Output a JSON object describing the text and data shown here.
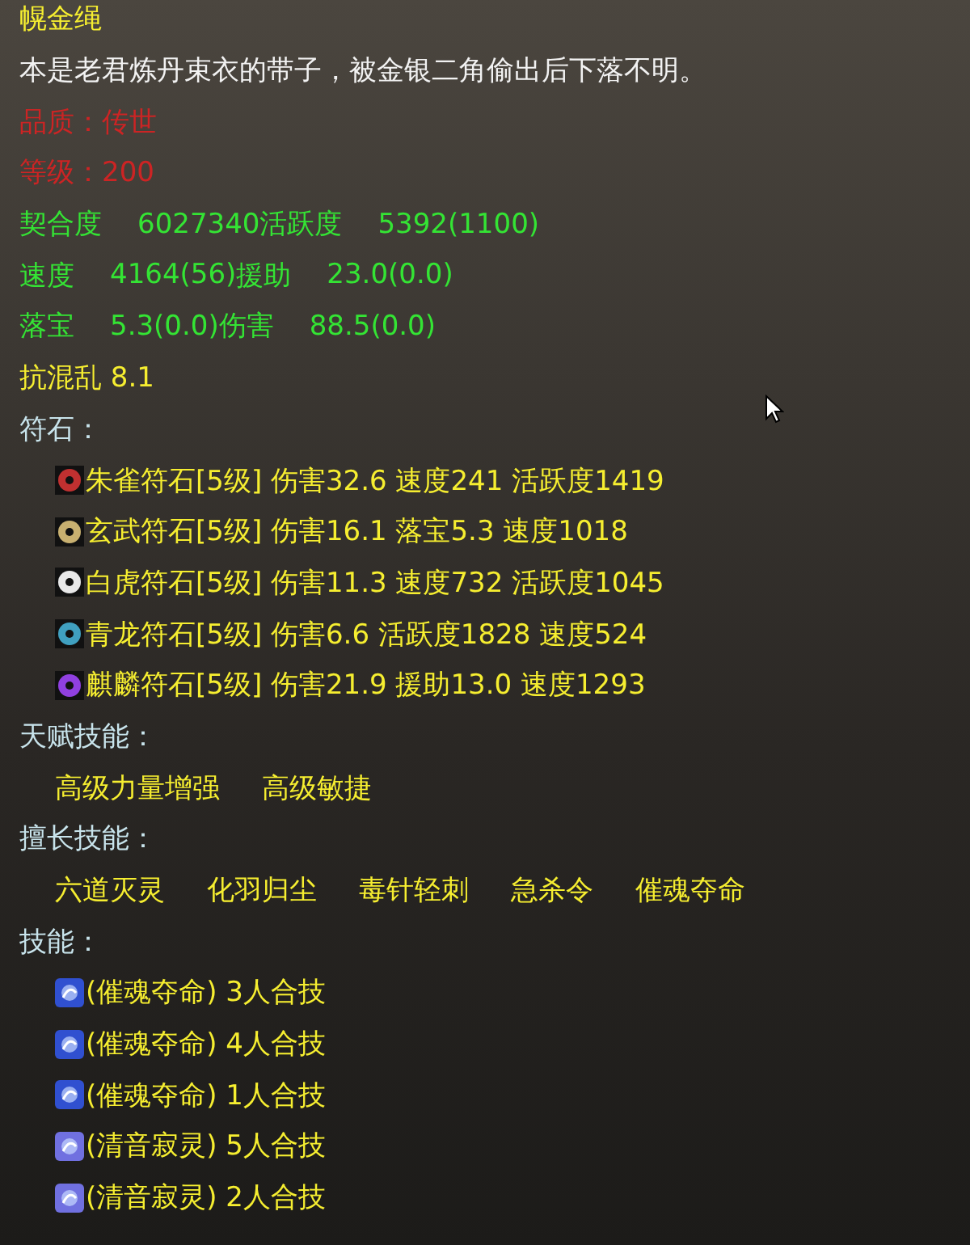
{
  "item": {
    "name": "幌金绳",
    "description": "本是老君炼丹束衣的带子，被金银二角偷出后下落不明。"
  },
  "attributes": [
    "品质：传世",
    "等级：200"
  ],
  "stats": [
    [
      {
        "label": "契合度",
        "value": "6027340"
      },
      {
        "label": "活跃度",
        "value": "5392(1100)"
      }
    ],
    [
      {
        "label": "速度",
        "value": "4164(56)"
      },
      {
        "label": "援助",
        "value": "23.0(0.0)"
      }
    ],
    [
      {
        "label": "落宝",
        "value": "5.3(0.0)"
      },
      {
        "label": "伤害",
        "value": "88.5(0.0)"
      }
    ]
  ],
  "resist": "抗混乱 8.1",
  "runes_heading": "符石：",
  "runes": [
    {
      "text": "朱雀符石[5级] 伤害32.6 速度241 活跃度1419",
      "color": "#c03030"
    },
    {
      "text": "玄武符石[5级] 伤害16.1 落宝5.3 速度1018",
      "color": "#c8b070"
    },
    {
      "text": "白虎符石[5级] 伤害11.3 速度732 活跃度1045",
      "color": "#e8e8e8"
    },
    {
      "text": "青龙符石[5级] 伤害6.6 活跃度1828 速度524",
      "color": "#40a0c0"
    },
    {
      "text": "麒麟符石[5级] 伤害21.9 援助13.0 速度1293",
      "color": "#9040e0"
    }
  ],
  "talent_heading": "天赋技能：",
  "talents": [
    "高级力量增强",
    "高级敏捷"
  ],
  "specialty_heading": "擅长技能：",
  "specialties": [
    "六道灭灵",
    "化羽归尘",
    "毒针轻刺",
    "急杀令",
    "催魂夺命"
  ],
  "skills_heading": "技能：",
  "skills": [
    {
      "text": "(催魂夺命) 3人合技",
      "color": "#3050d0"
    },
    {
      "text": "(催魂夺命) 4人合技",
      "color": "#3050d0"
    },
    {
      "text": "(催魂夺命) 1人合技",
      "color": "#3050d0"
    },
    {
      "text": "(清音寂灵) 5人合技",
      "color": "#7070e0"
    },
    {
      "text": "(清音寂灵) 2人合技",
      "color": "#7070e0"
    }
  ]
}
